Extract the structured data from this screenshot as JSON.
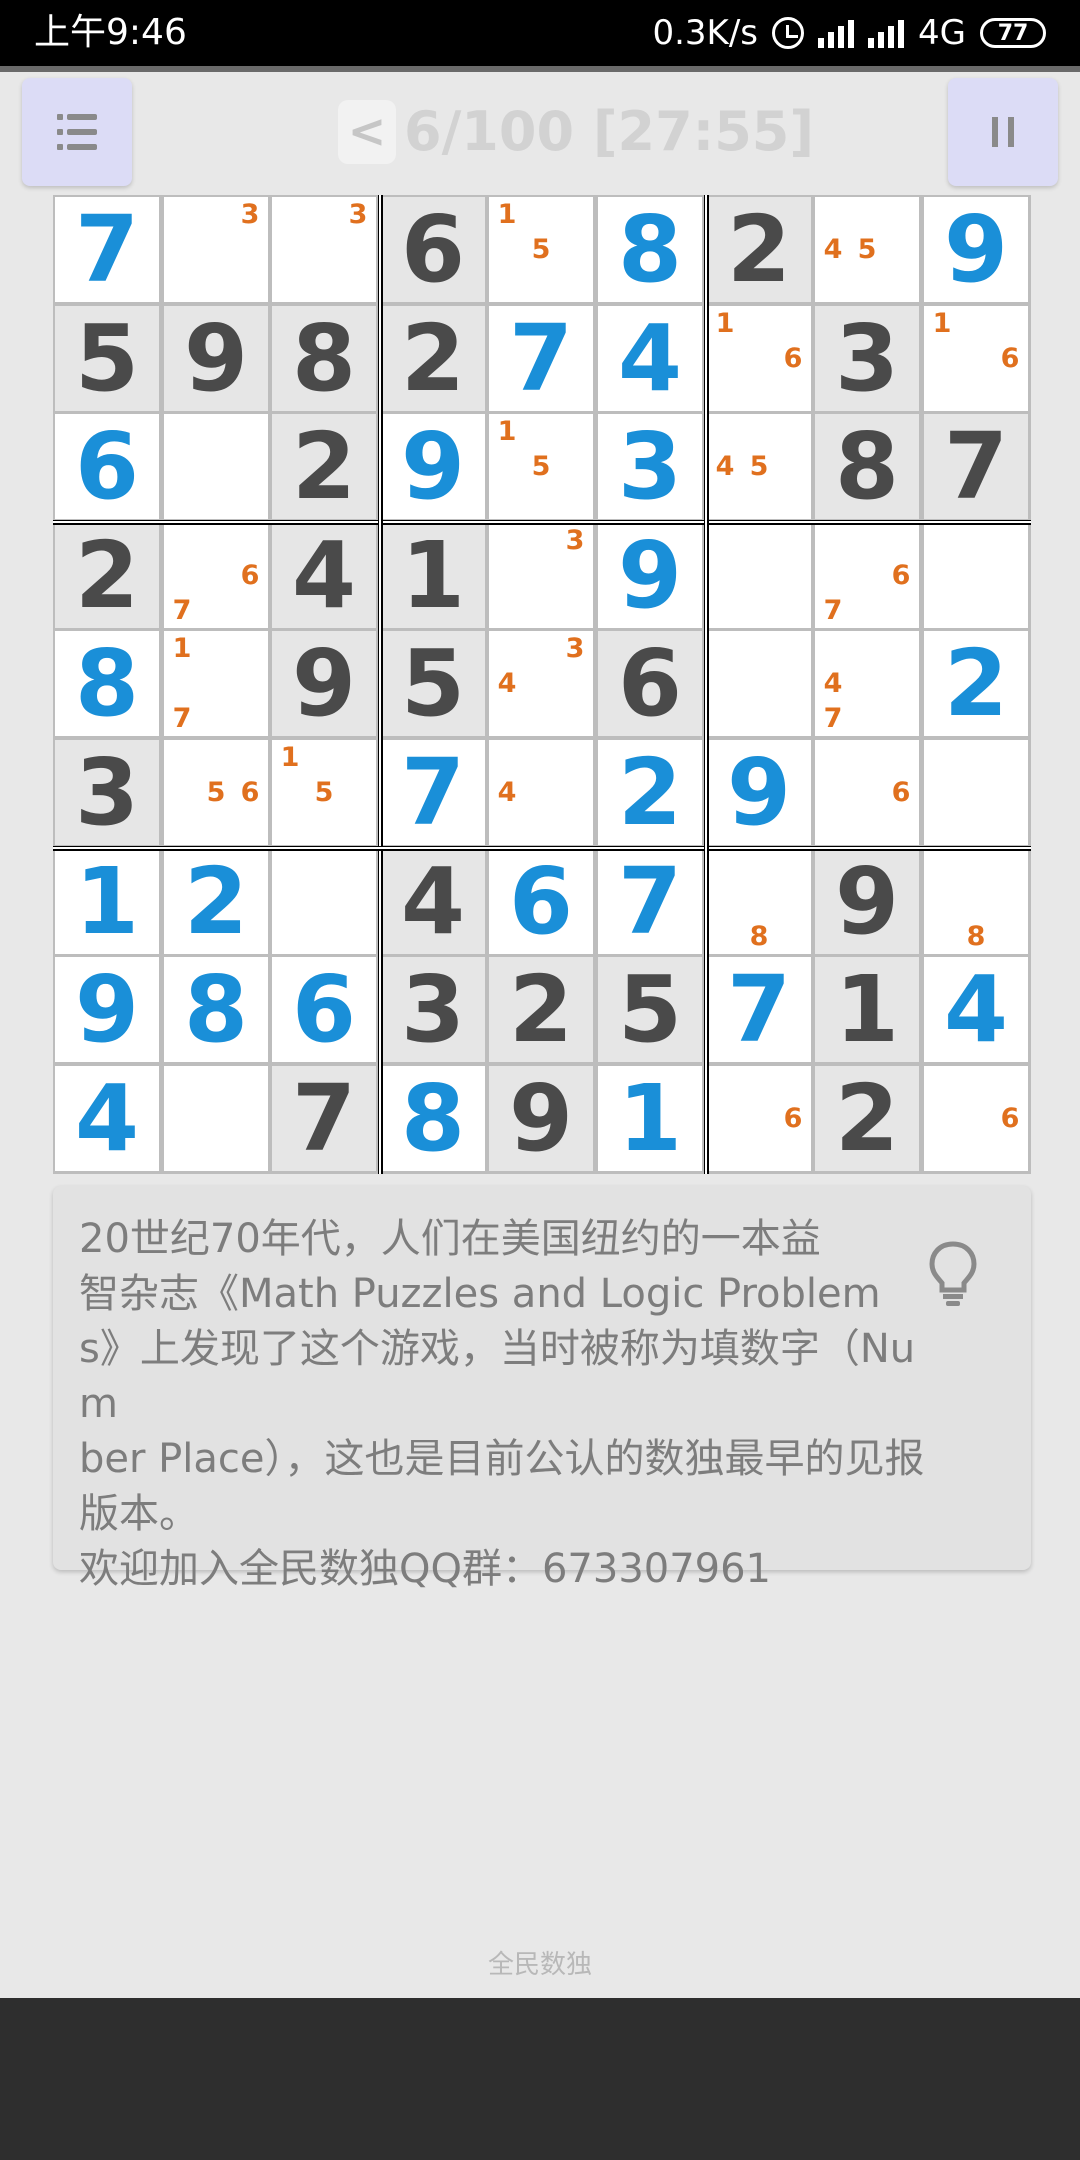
{
  "status_bar": {
    "time": "上午9:46",
    "network_speed": "0.3K/s",
    "network_type": "4G",
    "battery": "77",
    "icons": [
      "alarm-icon",
      "signal-icon",
      "hd-signal-icon",
      "battery-icon"
    ]
  },
  "toolbar": {
    "menu_icon": "list-icon",
    "prev_label": "<",
    "title": "6/100 [27:55]",
    "pause_icon": "pause-icon"
  },
  "board": {
    "values": [
      [
        7,
        0,
        0,
        6,
        0,
        8,
        2,
        0,
        9
      ],
      [
        5,
        9,
        8,
        2,
        7,
        4,
        0,
        3,
        0
      ],
      [
        6,
        0,
        2,
        9,
        0,
        3,
        0,
        8,
        7
      ],
      [
        2,
        0,
        4,
        1,
        0,
        9,
        0,
        0,
        0
      ],
      [
        8,
        0,
        9,
        5,
        0,
        6,
        0,
        0,
        2
      ],
      [
        3,
        0,
        0,
        7,
        0,
        2,
        9,
        0,
        0
      ],
      [
        1,
        2,
        0,
        4,
        6,
        7,
        0,
        9,
        0
      ],
      [
        9,
        8,
        6,
        3,
        2,
        5,
        7,
        1,
        4
      ],
      [
        4,
        0,
        7,
        8,
        9,
        1,
        0,
        2,
        0
      ]
    ],
    "given": [
      [
        0,
        0,
        0,
        1,
        0,
        0,
        1,
        0,
        0
      ],
      [
        1,
        1,
        1,
        1,
        0,
        0,
        0,
        1,
        0
      ],
      [
        0,
        0,
        1,
        0,
        0,
        0,
        0,
        1,
        1
      ],
      [
        1,
        0,
        1,
        1,
        0,
        0,
        0,
        0,
        0
      ],
      [
        0,
        0,
        1,
        1,
        0,
        1,
        0,
        0,
        0
      ],
      [
        1,
        0,
        0,
        0,
        0,
        0,
        0,
        0,
        0
      ],
      [
        0,
        0,
        0,
        1,
        0,
        0,
        0,
        1,
        0
      ],
      [
        0,
        0,
        0,
        1,
        1,
        1,
        0,
        1,
        0
      ],
      [
        0,
        0,
        1,
        0,
        1,
        0,
        0,
        1,
        0
      ]
    ],
    "notes": [
      {
        "r": 0,
        "c": 1,
        "n": [
          3
        ]
      },
      {
        "r": 0,
        "c": 2,
        "n": [
          3
        ]
      },
      {
        "r": 0,
        "c": 4,
        "n": [
          1,
          5
        ]
      },
      {
        "r": 0,
        "c": 7,
        "n": [
          4,
          5
        ]
      },
      {
        "r": 1,
        "c": 6,
        "n": [
          1,
          6
        ]
      },
      {
        "r": 1,
        "c": 8,
        "n": [
          1,
          6
        ]
      },
      {
        "r": 2,
        "c": 4,
        "n": [
          1,
          5
        ]
      },
      {
        "r": 2,
        "c": 6,
        "n": [
          4,
          5
        ]
      },
      {
        "r": 3,
        "c": 1,
        "n": [
          6,
          7
        ]
      },
      {
        "r": 3,
        "c": 4,
        "n": [
          3
        ]
      },
      {
        "r": 3,
        "c": 7,
        "n": [
          6,
          7
        ]
      },
      {
        "r": 4,
        "c": 1,
        "n": [
          1,
          7
        ]
      },
      {
        "r": 4,
        "c": 4,
        "n": [
          3,
          4
        ]
      },
      {
        "r": 4,
        "c": 7,
        "n": [
          4,
          7
        ]
      },
      {
        "r": 5,
        "c": 1,
        "n": [
          5,
          6
        ]
      },
      {
        "r": 5,
        "c": 2,
        "n": [
          1,
          5
        ]
      },
      {
        "r": 5,
        "c": 4,
        "n": [
          4
        ]
      },
      {
        "r": 5,
        "c": 7,
        "n": [
          6
        ]
      },
      {
        "r": 6,
        "c": 6,
        "n": [
          8
        ]
      },
      {
        "r": 6,
        "c": 8,
        "n": [
          8
        ]
      },
      {
        "r": 8,
        "c": 6,
        "n": [
          6
        ]
      },
      {
        "r": 8,
        "c": 8,
        "n": [
          6
        ]
      }
    ],
    "colors": {
      "given": "#4a4a4a",
      "user": "#1a8fd8",
      "note": "#e0701e",
      "given_bg": "#e6e6e6",
      "empty_bg": "#ffffff"
    }
  },
  "info": {
    "text_lines": [
      "20世纪70年代，人们在美国纽约的一本益",
      "智杂志《Math Puzzles and Logic Problem",
      "s》上发现了这个游戏，当时被称为填数字（Num",
      "ber Place），这也是目前公认的数独最早的见报",
      "版本。",
      "欢迎加入全民数独QQ群：673307961"
    ],
    "hint_icon": "lightbulb-icon"
  },
  "footer": {
    "app_name": "全民数独"
  }
}
